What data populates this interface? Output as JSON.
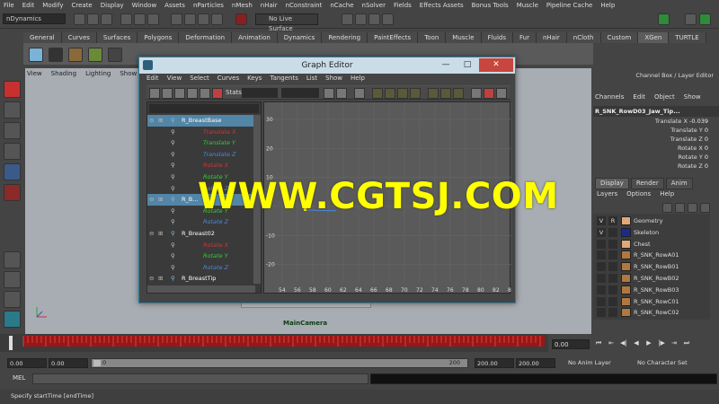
{
  "menubar": [
    "File",
    "Edit",
    "Modify",
    "Create",
    "Display",
    "Window",
    "Assets",
    "nParticles",
    "nMesh",
    "nHair",
    "nConstraint",
    "nCache",
    "nSolver",
    "Fields",
    "Effects Assets",
    "Bonus Tools",
    "Muscle",
    "Pipeline Cache",
    "Help"
  ],
  "status": {
    "menuset": "nDynamics",
    "live_surface": "No Live Surface"
  },
  "shelf_tabs": [
    "General",
    "Curves",
    "Surfaces",
    "Polygons",
    "Deformation",
    "Animation",
    "Dynamics",
    "Rendering",
    "PaintEffects",
    "Toon",
    "Muscle",
    "Fluids",
    "Fur",
    "nHair",
    "nCloth",
    "Custom",
    "XGen",
    "TURTLE"
  ],
  "shelf_active": "XGen",
  "viewport": {
    "menu": [
      "View",
      "Shading",
      "Lighting",
      "Show"
    ],
    "camera_label": "MainCamera"
  },
  "graph_editor": {
    "title": "Graph Editor",
    "controls": {
      "minimize": "—",
      "maximize": "□",
      "close": "✕"
    },
    "menu": [
      "Edit",
      "View",
      "Select",
      "Curves",
      "Keys",
      "Tangents",
      "List",
      "Show",
      "Help"
    ],
    "stats_label": "Stats",
    "outliner": [
      {
        "label": "R_BreastBase",
        "kind": "node",
        "selected": true,
        "color": "#ffffff"
      },
      {
        "label": "Translate X",
        "kind": "channel",
        "color": "#e03030"
      },
      {
        "label": "Translate Y",
        "kind": "channel",
        "color": "#30d030"
      },
      {
        "label": "Translate Z",
        "kind": "channel",
        "color": "#4a8ae0"
      },
      {
        "label": "Rotate X",
        "kind": "channel",
        "color": "#e03030"
      },
      {
        "label": "Rotate Y",
        "kind": "channel",
        "color": "#30d030"
      },
      {
        "label": "Rotate Z",
        "kind": "channel",
        "color": "#4a8ae0"
      },
      {
        "label": "R_B...",
        "kind": "node",
        "selected": true,
        "color": "#ffffff"
      },
      {
        "label": "Rotate Y",
        "kind": "channel",
        "color": "#30d030"
      },
      {
        "label": "Rotate Z",
        "kind": "channel",
        "color": "#4a8ae0"
      },
      {
        "label": "R_Breast02",
        "kind": "node",
        "color": "#ffffff"
      },
      {
        "label": "Rotate X",
        "kind": "channel",
        "color": "#e03030"
      },
      {
        "label": "Rotate Y",
        "kind": "channel",
        "color": "#30d030"
      },
      {
        "label": "Rotate Z",
        "kind": "channel",
        "color": "#4a8ae0"
      },
      {
        "label": "R_BreastTip",
        "kind": "node",
        "color": "#ffffff"
      }
    ],
    "graph": {
      "y_ticks": [
        "30",
        "20",
        "10",
        "0",
        "-10",
        "-20"
      ],
      "y_values": [
        30,
        20,
        10,
        0,
        -10,
        -20
      ],
      "x_ticks": [
        "54",
        "56",
        "58",
        "60",
        "62",
        "64",
        "66",
        "68",
        "70",
        "72",
        "74",
        "76",
        "78",
        "80",
        "82",
        "8"
      ]
    }
  },
  "channel_box": {
    "title": "Channel Box / Layer Editor",
    "menu": [
      "Channels",
      "Edit",
      "Object",
      "Show"
    ],
    "node": "R_SNK_RowD03_Jaw_Tip...",
    "attrs": [
      {
        "name": "Translate X",
        "value": "-0.039"
      },
      {
        "name": "Translate Y",
        "value": "0"
      },
      {
        "name": "Translate Z",
        "value": "0"
      },
      {
        "name": "Rotate X",
        "value": "0"
      },
      {
        "name": "Rotate Y",
        "value": "0"
      },
      {
        "name": "Rotate Z",
        "value": "0"
      }
    ]
  },
  "layer_editor": {
    "tabs": [
      "Display",
      "Render",
      "Anim"
    ],
    "menu": [
      "Layers",
      "Options",
      "Help"
    ],
    "layers": [
      {
        "v": "V",
        "r": "R",
        "color": "#e0a878",
        "name": "Geometry"
      },
      {
        "v": "V",
        "r": "",
        "color": "#1c2a8c",
        "name": "Skeleton"
      },
      {
        "v": "",
        "r": "",
        "color": "#e0a878",
        "name": "Chest"
      },
      {
        "v": "",
        "r": "",
        "color": "#b07840",
        "name": "R_SNK_RowA01"
      },
      {
        "v": "",
        "r": "",
        "color": "#b07840",
        "name": "R_SNK_RowB01"
      },
      {
        "v": "",
        "r": "",
        "color": "#b07840",
        "name": "R_SNK_RowB02"
      },
      {
        "v": "",
        "r": "",
        "color": "#b07840",
        "name": "R_SNK_RowB03"
      },
      {
        "v": "",
        "r": "",
        "color": "#b07840",
        "name": "R_SNK_RowC01"
      },
      {
        "v": "",
        "r": "",
        "color": "#b07840",
        "name": "R_SNK_RowC02"
      }
    ]
  },
  "timeline": {
    "current": "0.00"
  },
  "range": {
    "start": "0.00",
    "inner_start": "0.00",
    "slider_start": "0",
    "slider_end": "200",
    "end": "200.00",
    "outer_end": "200.00",
    "anim_layer": "No Anim Layer",
    "character_set": "No Character Set"
  },
  "command": {
    "mel": "MEL"
  },
  "help_line": "Specify startTime [endTime]",
  "watermark": "WWW.CGTSJ.COM",
  "colors": {
    "accent": "#2c7f9f",
    "viewport": "#a7adb3",
    "timeline_red": "#9a1616"
  }
}
